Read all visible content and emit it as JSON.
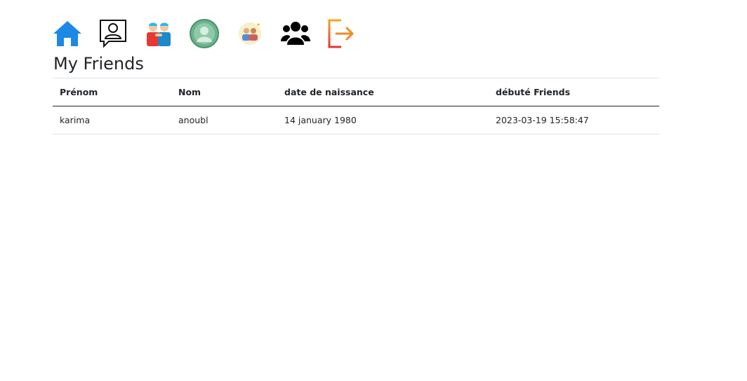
{
  "nav": {
    "icons": [
      "home-icon",
      "profile-chat-icon",
      "friends-icon",
      "avatar-icon",
      "friend-requests-icon",
      "groups-icon",
      "logout-icon"
    ]
  },
  "page": {
    "title": "My Friends"
  },
  "table": {
    "headers": [
      "Prénom",
      "Nom",
      "date de naissance",
      "débuté Friends"
    ],
    "rows": [
      [
        "karima",
        "anoubl",
        "14 january 1980",
        "2023-03-19 15:58:47"
      ]
    ]
  },
  "colors": {
    "home": "#1e88e5",
    "logout_top": "#f7a21b",
    "logout_bottom": "#e9342e",
    "avatar": "#6ab48e",
    "friends_red": "#e53935",
    "friends_blue": "#1e88c8"
  }
}
